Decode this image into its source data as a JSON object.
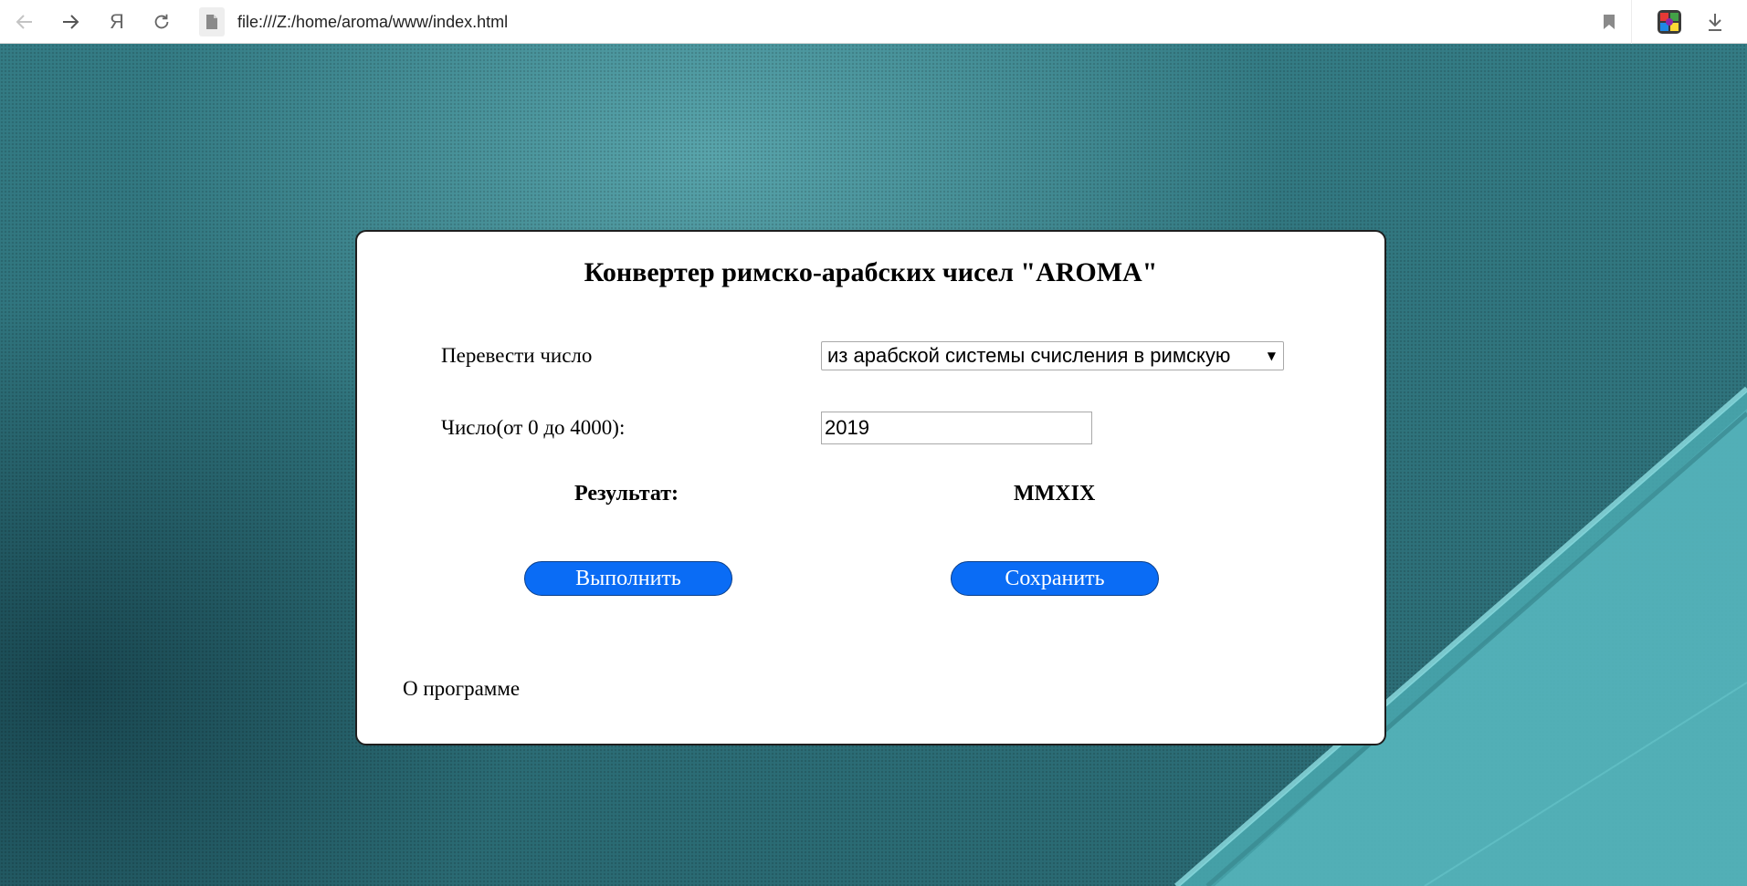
{
  "browser": {
    "url": "file:///Z:/home/aroma/www/index.html",
    "home_glyph": "Я"
  },
  "converter": {
    "title": "Конвертер римско-арабских чисел \"AROMA\"",
    "convert_label": "Перевести число",
    "mode_selected": "из арабской системы счисления в римскую",
    "number_label": "Число(от 0 до 4000):",
    "number_value": "2019",
    "result_label": "Результат:",
    "result_value": "MMXIX",
    "execute_label": "Выполнить",
    "save_label": "Сохранить",
    "about_label": "О программе"
  },
  "colors": {
    "button": "#0a6cf5",
    "background": "#2f737c"
  }
}
